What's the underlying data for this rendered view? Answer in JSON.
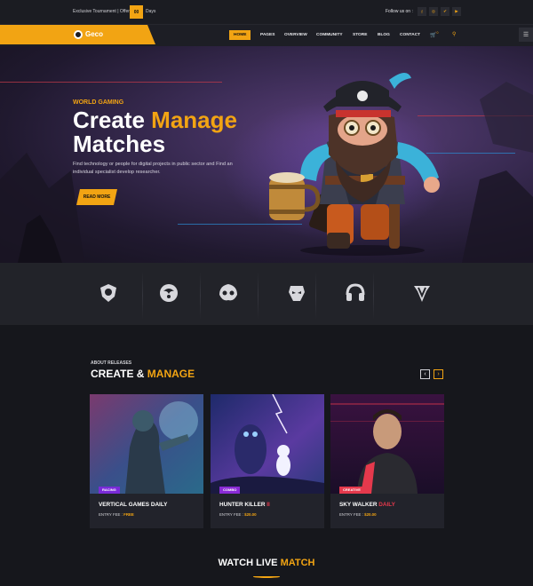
{
  "topbar": {
    "tournament_text": "Exclusive Tournament | Offer",
    "days_number": "00",
    "days_label": "Days",
    "follow_label": "Follow us on :",
    "social": [
      {
        "icon": "facebook-icon",
        "glyph": "f"
      },
      {
        "icon": "instagram-icon",
        "glyph": "◎"
      },
      {
        "icon": "twitter-icon",
        "glyph": "✔"
      },
      {
        "icon": "youtube-icon",
        "glyph": "▶"
      }
    ]
  },
  "header": {
    "logo_text": "Geco",
    "nav": [
      "HOME",
      "PAGES",
      "OVERVIEW",
      "COMMUNITY",
      "STORE",
      "BLOG",
      "CONTACT"
    ],
    "active_nav": "HOME",
    "cart_count": "0"
  },
  "hero": {
    "eyebrow": "WORLD GAMING",
    "title_white": "Create ",
    "title_accent": "Manage",
    "title_line2": "Matches",
    "description": "Find technology or people for digital projects in public sector and Find an individual specialist develop researcher.",
    "button_label": "READ MORE"
  },
  "brands": [
    {
      "icon": "shield-emblem-icon"
    },
    {
      "icon": "dragon-emblem-icon"
    },
    {
      "icon": "gamepad-skull-icon"
    },
    {
      "icon": "warrior-head-icon"
    },
    {
      "icon": "headset-icon"
    },
    {
      "icon": "crest-v-icon"
    }
  ],
  "releases": {
    "eyebrow": "ABOUT RELEASES",
    "title_white": "CREATE & ",
    "title_accent": "MANAGE",
    "prev_label": "‹",
    "next_label": "›",
    "cards": [
      {
        "tag": "RACING",
        "tag_color": "#7a2bd8",
        "name_white": "VERTICAL GAMES DAILY",
        "name_accent": "",
        "fee_label": "ENTRY FEE : ",
        "fee_value": "FREE"
      },
      {
        "tag": "COMBO",
        "tag_color": "#8a2bd6",
        "name_white": "HUNTER KILLER ",
        "name_accent": "II",
        "fee_label": "ENTRY FEE : ",
        "fee_value": "$20.00"
      },
      {
        "tag": "CREATIVE",
        "tag_color": "#e5394c",
        "name_white": "SKY WALKER ",
        "name_accent": "DAILY",
        "fee_label": "ENTRY FEE : ",
        "fee_value": "$20.00"
      }
    ]
  },
  "watch": {
    "title_white": "WATCH LIVE ",
    "title_accent": "MATCH"
  },
  "colors": {
    "accent": "#f2a413",
    "background": "#15161b",
    "card": "#22232b",
    "red": "#e5394c"
  }
}
